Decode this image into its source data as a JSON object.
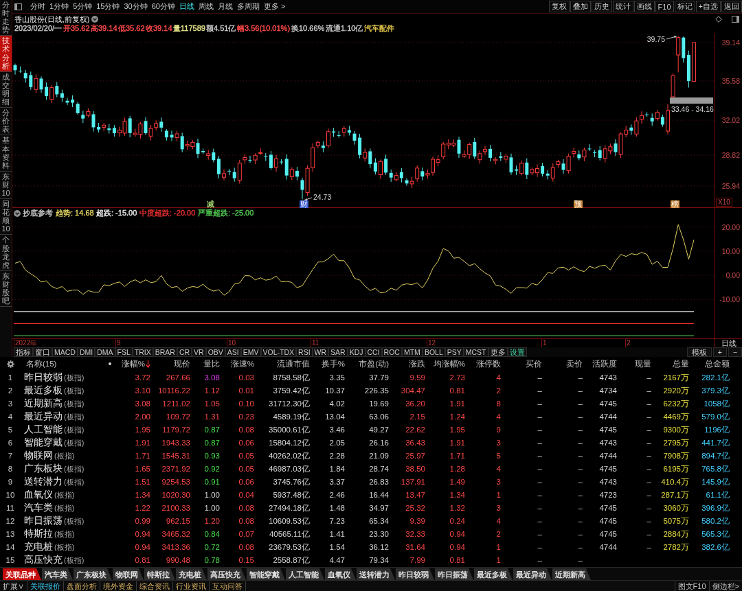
{
  "side_tabs": [
    {
      "label": "分时走势",
      "selected": false
    },
    {
      "label": "技术分析",
      "selected": true
    },
    {
      "label": "成交明细",
      "selected": false
    },
    {
      "label": "分价表",
      "selected": false
    },
    {
      "label": "基本资料",
      "selected": false
    },
    {
      "label": "东财10",
      "selected": false
    },
    {
      "label": "同花顺10",
      "selected": false
    },
    {
      "label": "个股龙虎",
      "selected": false
    },
    {
      "label": "东财股吧",
      "selected": false
    }
  ],
  "toolbar": {
    "periods": [
      {
        "label": "分时",
        "selected": false
      },
      {
        "label": "1分钟",
        "selected": false
      },
      {
        "label": "5分钟",
        "selected": false
      },
      {
        "label": "15分钟",
        "selected": false
      },
      {
        "label": "30分钟",
        "selected": false
      },
      {
        "label": "60分钟",
        "selected": false
      },
      {
        "label": "日线",
        "selected": true
      },
      {
        "label": "周线",
        "selected": false
      },
      {
        "label": "月线",
        "selected": false
      },
      {
        "label": "多周期",
        "selected": false
      },
      {
        "label": "更多 >",
        "selected": false
      }
    ],
    "actions": [
      "复权",
      "叠加",
      "历史",
      "统计",
      "画线",
      "F10",
      "标记",
      "+自选",
      "返回"
    ]
  },
  "stock": {
    "title": "香山股份(日线,前复权)",
    "quote": [
      {
        "text": "2023/02/20/一",
        "color": "#c8c8c8"
      },
      {
        "text": "开35.62",
        "color": "#ff4a4a"
      },
      {
        "text": "高39.14",
        "color": "#ff4a4a"
      },
      {
        "text": "低35.62",
        "color": "#ff4a4a"
      },
      {
        "text": "收39.14",
        "color": "#ff4a4a"
      },
      {
        "text": "量117589",
        "color": "#e6e68c"
      },
      {
        "text": "额4.51亿",
        "color": "#c8c8c8"
      },
      {
        "text": "幅3.56(10.01%)",
        "color": "#ff4a4a"
      },
      {
        "text": "换10.66%",
        "color": "#c8c8c8"
      },
      {
        "text": "流通1.10亿",
        "color": "#c8c8c8"
      },
      {
        "text": "汽车配件",
        "color": "#e6c84a"
      }
    ]
  },
  "price_chart": {
    "y_labels": [
      "39.14",
      "35.58",
      "32.02",
      "28.82",
      "25.94"
    ],
    "high_label": "39.75",
    "gap_label": "33.46 - 34.16",
    "low_label": "24.73",
    "markers": [
      {
        "label": "减",
        "kind": "plain",
        "color": "#a0d070"
      },
      {
        "label": "财",
        "kind": "boxed",
        "color": "#3a5bd0"
      },
      {
        "label": "预",
        "kind": "boxed",
        "color": "#c8843a"
      },
      {
        "label": "榜",
        "kind": "boxed",
        "color": "#c8843a"
      }
    ],
    "scale": "X10"
  },
  "indicator": {
    "name": "抄底参考",
    "lines": [
      {
        "label": "趋势: 14.68",
        "kind": "curve",
        "color": "#e0d060"
      },
      {
        "label": "超跌: -15.00",
        "kind": "level",
        "color": "#e8e8e8"
      },
      {
        "label": "中度超跌: -20.00",
        "kind": "level",
        "color": "#e83030"
      },
      {
        "label": "严重超跌: -25.00",
        "kind": "level",
        "color": "#50c850"
      }
    ],
    "y_labels": [
      "20.00",
      "10.00",
      "0.00",
      "-10.00"
    ]
  },
  "date_axis": {
    "labels": [
      "2022年",
      "9",
      "10",
      "11",
      "12",
      "1",
      "2"
    ],
    "period": "日线"
  },
  "indicator_tabs": [
    {
      "label": "指标",
      "kind": "tab"
    },
    {
      "label": "窗口",
      "kind": "tab"
    },
    {
      "label": "MACD",
      "kind": "tab"
    },
    {
      "label": "DMI",
      "kind": "tab"
    },
    {
      "label": "DMA",
      "kind": "tab"
    },
    {
      "label": "FSL",
      "kind": "tab"
    },
    {
      "label": "TRIX",
      "kind": "tab"
    },
    {
      "label": "BRAR",
      "kind": "tab"
    },
    {
      "label": "CR",
      "kind": "tab"
    },
    {
      "label": "VR",
      "kind": "tab"
    },
    {
      "label": "OBV",
      "kind": "tab"
    },
    {
      "label": "ASI",
      "kind": "tab"
    },
    {
      "label": "EMV",
      "kind": "tab"
    },
    {
      "label": "VOL-TDX",
      "kind": "tab"
    },
    {
      "label": "RSI",
      "kind": "tab"
    },
    {
      "label": "WR",
      "kind": "tab"
    },
    {
      "label": "SAR",
      "kind": "tab"
    },
    {
      "label": "KDJ",
      "kind": "tab"
    },
    {
      "label": "CCI",
      "kind": "tab"
    },
    {
      "label": "ROC",
      "kind": "tab"
    },
    {
      "label": "MTM",
      "kind": "tab"
    },
    {
      "label": "BOLL",
      "kind": "tab"
    },
    {
      "label": "PSY",
      "kind": "tab"
    },
    {
      "label": "MCST",
      "kind": "tab"
    },
    {
      "label": "更多",
      "kind": "tab"
    },
    {
      "label": "设置",
      "kind": "link"
    }
  ],
  "template_buttons": [
    "模板",
    "+",
    "−"
  ],
  "table": {
    "columns": [
      {
        "label": "名称(15)",
        "sorted": false
      },
      {
        "label": "涨幅%",
        "sorted": true
      },
      {
        "label": "现价",
        "sorted": false
      },
      {
        "label": "量比",
        "sorted": false
      },
      {
        "label": "涨速%",
        "sorted": false
      },
      {
        "label": "流通市值",
        "sorted": false
      },
      {
        "label": "换手%",
        "sorted": false
      },
      {
        "label": "市盈(动)",
        "sorted": false
      },
      {
        "label": "涨跌",
        "sorted": false
      },
      {
        "label": "均涨幅%",
        "sorted": false
      },
      {
        "label": "涨停数",
        "sorted": false
      },
      {
        "label": "买价",
        "sorted": false
      },
      {
        "label": "卖价",
        "sorted": false
      },
      {
        "label": "活跃度",
        "sorted": false
      },
      {
        "label": "现量",
        "sorted": false
      },
      {
        "label": "总量",
        "sorted": false
      },
      {
        "label": "总金额",
        "sorted": false
      }
    ],
    "rows": [
      {
        "rank": "1",
        "name": "昨日较弱",
        "tag": "(板指)",
        "values": [
          "3.72",
          "267.66",
          {
            "text": "3.08",
            "color": "#e040f0"
          },
          "0.03",
          "8758.58亿",
          "3.35",
          "37.79",
          "9.59",
          "2.73",
          "4",
          "–",
          "–",
          "4743",
          "–",
          "2167万",
          "282.1亿"
        ]
      },
      {
        "rank": "2",
        "name": "最近多板",
        "tag": "(板指)",
        "values": [
          "3.10",
          "10116.22",
          {
            "text": "1.12",
            "color": "#ff4848"
          },
          "0.01",
          "3759.42亿",
          "10.37",
          "226.35",
          "304.47",
          "0.81",
          "2",
          "–",
          "–",
          "4734",
          "–",
          "2920万",
          "379.3亿"
        ]
      },
      {
        "rank": "3",
        "name": "近期新高",
        "tag": "(板指)",
        "values": [
          "3.08",
          "1211.02",
          {
            "text": "1.05",
            "color": "#ff4848"
          },
          "0.10",
          "31712.30亿",
          "4.02",
          "19.69",
          "36.20",
          "1.91",
          "8",
          "–",
          "–",
          "4745",
          "–",
          "6232万",
          "1058亿"
        ]
      },
      {
        "rank": "4",
        "name": "最近异动",
        "tag": "(板指)",
        "values": [
          "2.00",
          "109.72",
          {
            "text": "1.31",
            "color": "#ff4848"
          },
          "0.23",
          "4589.19亿",
          "13.04",
          "63.06",
          "2.15",
          "1.24",
          "4",
          "–",
          "–",
          "4744",
          "–",
          "4469万",
          "579.0亿"
        ]
      },
      {
        "rank": "5",
        "name": "人工智能",
        "tag": "(板指)",
        "values": [
          "1.95",
          "1179.72",
          {
            "text": "0.87",
            "color": "#48e048"
          },
          "0.08",
          "35000.61亿",
          "3.46",
          "49.27",
          "22.62",
          "1.95",
          "9",
          "–",
          "–",
          "4745",
          "–",
          "9300万",
          "1196亿"
        ]
      },
      {
        "rank": "6",
        "name": "智能穿戴",
        "tag": "(板指)",
        "values": [
          "1.91",
          "1943.33",
          {
            "text": "0.87",
            "color": "#48e048"
          },
          "0.06",
          "15804.12亿",
          "2.05",
          "26.16",
          "36.43",
          "1.91",
          "3",
          "–",
          "–",
          "4743",
          "–",
          "2795万",
          "441.7亿"
        ]
      },
      {
        "rank": "7",
        "name": "物联网",
        "tag": "(板指)",
        "values": [
          "1.71",
          "1545.31",
          {
            "text": "0.93",
            "color": "#48e048"
          },
          "0.05",
          "40262.02亿",
          "2.28",
          "21.09",
          "25.97",
          "1.71",
          "5",
          "–",
          "–",
          "4744",
          "–",
          "7908万",
          "894.7亿"
        ]
      },
      {
        "rank": "8",
        "name": "广东板块",
        "tag": "(板指)",
        "values": [
          "1.65",
          "2371.92",
          {
            "text": "0.92",
            "color": "#48e048"
          },
          "0.05",
          "46987.03亿",
          "1.84",
          "28.74",
          "38.50",
          "1.28",
          "4",
          "–",
          "–",
          "4745",
          "–",
          "6195万",
          "765.8亿"
        ]
      },
      {
        "rank": "9",
        "name": "送转潜力",
        "tag": "(板指)",
        "values": [
          "1.51",
          "9254.53",
          {
            "text": "0.91",
            "color": "#48e048"
          },
          "0.06",
          "3745.76亿",
          "3.37",
          "26.83",
          "137.91",
          "1.49",
          "3",
          "–",
          "–",
          "4743",
          "–",
          "410.4万",
          "145.9亿"
        ]
      },
      {
        "rank": "10",
        "name": "血氧仪",
        "tag": "(板指)",
        "values": [
          "1.34",
          "1020.30",
          {
            "text": "1.00",
            "color": "#d8d8d8"
          },
          "0.04",
          "5937.48亿",
          "2.46",
          "16.44",
          "13.47",
          "1.34",
          "1",
          "–",
          "–",
          "4723",
          "–",
          "287.1万",
          "61.1亿"
        ]
      },
      {
        "rank": "11",
        "name": "汽车类",
        "tag": "(板指)",
        "values": [
          "1.22",
          "2100.33",
          {
            "text": "1.00",
            "color": "#d8d8d8"
          },
          "0.08",
          "27494.18亿",
          "1.48",
          "34.97",
          "25.32",
          "1.32",
          "3",
          "–",
          "–",
          "4745",
          "–",
          "3060万",
          "396.9亿"
        ]
      },
      {
        "rank": "12",
        "name": "昨日振荡",
        "tag": "(板指)",
        "values": [
          "0.99",
          "962.15",
          {
            "text": "1.20",
            "color": "#ff4848"
          },
          "0.08",
          "10609.53亿",
          "7.23",
          "65.34",
          "9.39",
          "0.24",
          "4",
          "–",
          "–",
          "4745",
          "–",
          "5075万",
          "580.2亿"
        ]
      },
      {
        "rank": "13",
        "name": "特斯拉",
        "tag": "(板指)",
        "values": [
          "0.94",
          "3465.32",
          {
            "text": "0.84",
            "color": "#48e048"
          },
          "0.07",
          "40565.11亿",
          "1.41",
          "23.30",
          "32.33",
          "0.94",
          "2",
          "–",
          "–",
          "4745",
          "–",
          "2884万",
          "565.3亿"
        ]
      },
      {
        "rank": "14",
        "name": "充电桩",
        "tag": "(板指)",
        "values": [
          "0.94",
          "3413.36",
          {
            "text": "0.72",
            "color": "#48e048"
          },
          "0.08",
          "23679.53亿",
          "1.54",
          "36.12",
          "31.64",
          "0.94",
          "1",
          "–",
          "–",
          "4744",
          "–",
          "2782万",
          "382.6亿"
        ]
      },
      {
        "rank": "15",
        "name": "高压快充",
        "tag": "(板指)",
        "values": [
          "0.81",
          "990.48",
          {
            "text": "0.78",
            "color": "#48e048"
          },
          "0.15",
          "2558.87亿",
          "4.47",
          "79.34",
          "7.99",
          "0.81",
          "1",
          "–",
          "–"
        ]
      }
    ]
  },
  "sector_tabs": [
    {
      "label": "关联品种",
      "selected": true
    },
    {
      "label": "汽车类",
      "selected": false
    },
    {
      "label": "广东板块",
      "selected": false
    },
    {
      "label": "物联网",
      "selected": false
    },
    {
      "label": "特斯拉",
      "selected": false
    },
    {
      "label": "充电桩",
      "selected": false
    },
    {
      "label": "高压快充",
      "selected": false
    },
    {
      "label": "智能穿戴",
      "selected": false
    },
    {
      "label": "人工智能",
      "selected": false
    },
    {
      "label": "血氧仪",
      "selected": false
    },
    {
      "label": "送转潜力",
      "selected": false
    },
    {
      "label": "昨日较弱",
      "selected": false
    },
    {
      "label": "昨日振荡",
      "selected": false
    },
    {
      "label": "最近多板",
      "selected": false
    },
    {
      "label": "最近异动",
      "selected": false
    },
    {
      "label": "近期新高",
      "selected": false
    }
  ],
  "status_bar": {
    "tabs": [
      {
        "label": "扩展∨",
        "kind": "menu",
        "selected": false
      },
      {
        "label": "关联报价",
        "kind": "tab",
        "selected": true
      },
      {
        "label": "盘面分析",
        "kind": "tab",
        "selected": false
      },
      {
        "label": "境外资金",
        "kind": "tab",
        "selected": false
      },
      {
        "label": "综合资讯",
        "kind": "tab",
        "selected": false
      },
      {
        "label": "行业资讯",
        "kind": "tab",
        "selected": false
      },
      {
        "label": "互动问答",
        "kind": "tab",
        "selected": false
      }
    ],
    "right": [
      "图文F10",
      "侧边栏>"
    ]
  }
}
